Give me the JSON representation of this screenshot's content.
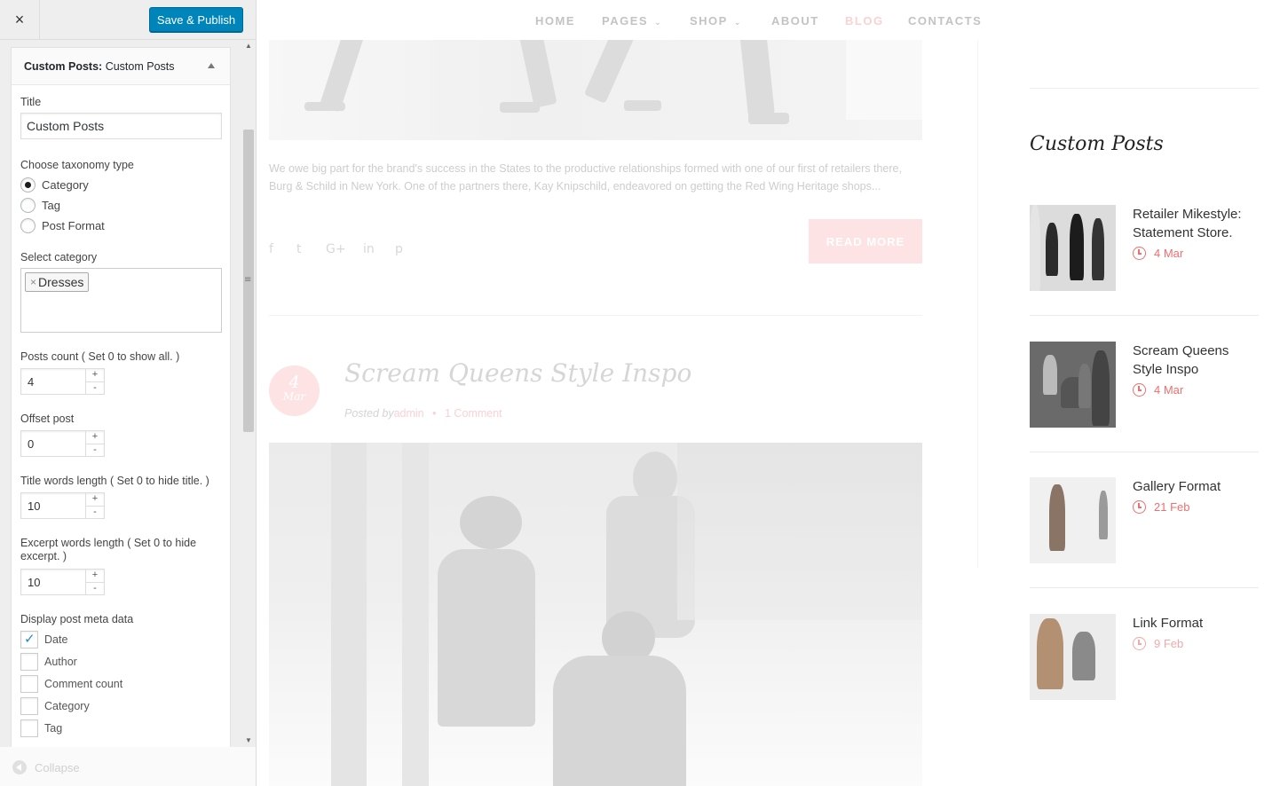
{
  "customizer": {
    "close_icon": "×",
    "publish_label": "Save & Publish",
    "widget": {
      "title_prefix": "Custom Posts:",
      "title_name": "Custom Posts",
      "title_label": "Title",
      "title_value": "Custom Posts",
      "taxonomy_label": "Choose taxonomy type",
      "taxonomy_options": [
        "Category",
        "Tag",
        "Post Format"
      ],
      "taxonomy_selected": "Category",
      "select_category_label": "Select category",
      "selected_category": "Dresses",
      "tag_remove": "×",
      "posts_count_label": "Posts count ( Set 0 to show all. )",
      "posts_count": "4",
      "offset_label": "Offset post",
      "offset": "0",
      "title_words_label": "Title words length ( Set 0 to hide title. )",
      "title_words": "10",
      "excerpt_words_label": "Excerpt words length ( Set 0 to hide excerpt. )",
      "excerpt_words": "10",
      "spin_up": "+",
      "spin_down": "-",
      "meta_label": "Display post meta data",
      "meta_options": [
        {
          "label": "Date",
          "checked": true
        },
        {
          "label": "Author",
          "checked": false
        },
        {
          "label": "Comment count",
          "checked": false
        },
        {
          "label": "Category",
          "checked": false
        },
        {
          "label": "Tag",
          "checked": false
        }
      ]
    },
    "collapse_label": "Collapse",
    "accent_color": "#0085ba"
  },
  "site": {
    "nav": [
      {
        "label": "HOME",
        "dropdown": false,
        "active": false
      },
      {
        "label": "PAGES",
        "dropdown": true,
        "active": false
      },
      {
        "label": "SHOP",
        "dropdown": true,
        "active": false
      },
      {
        "label": "ABOUT",
        "dropdown": false,
        "active": false
      },
      {
        "label": "BLOG",
        "dropdown": false,
        "active": true
      },
      {
        "label": "CONTACTS",
        "dropdown": false,
        "active": false
      }
    ],
    "chevron": "⌄",
    "post1": {
      "excerpt": "We owe big part for the brand's success in the States to the productive relationships formed with one of our first of retailers there, Burg & Schild in New York. One of the partners there, Kay Knipschild, endeavored on getting the Red Wing Heritage shops...",
      "read_more": "READ MORE",
      "social_icons": [
        "f",
        "t",
        "G+",
        "in",
        "p"
      ]
    },
    "post2": {
      "date_day": "4",
      "date_month": "Mar",
      "title": "Scream Queens Style Inspo",
      "posted_by": "Posted by",
      "author": "admin",
      "bullet": "•",
      "comments": "1 Comment"
    },
    "sidebar_widget": {
      "heading": "Custom Posts",
      "items": [
        {
          "title": "Retailer Mikestyle: Statement Store.",
          "date": "4 Mar"
        },
        {
          "title": "Scream Queens Style Inspo",
          "date": "4 Mar"
        },
        {
          "title": "Gallery Format",
          "date": "21 Feb"
        },
        {
          "title": "Link Format",
          "date": "9 Feb"
        }
      ]
    },
    "accent_color": "#ef6f6f"
  }
}
